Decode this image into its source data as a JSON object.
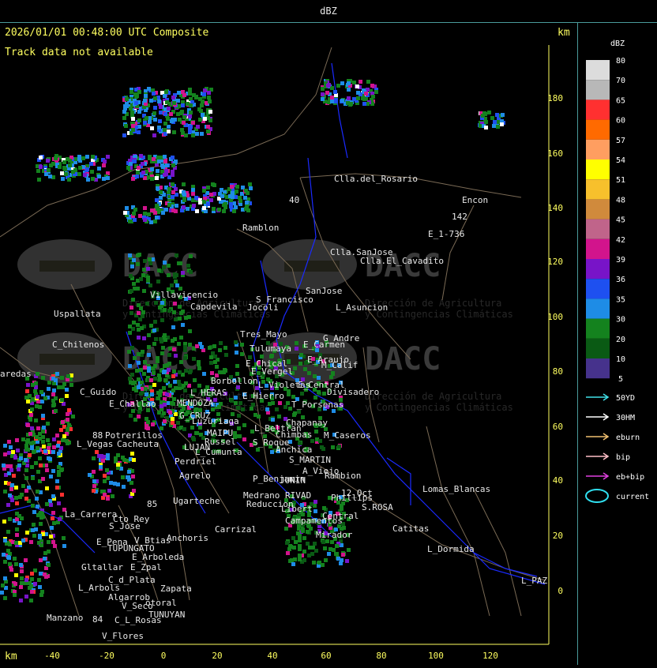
{
  "window": {
    "title": "dBZ"
  },
  "map": {
    "header": "2026/01/01 00:48:00 UTC Composite",
    "notice": "Track data not available",
    "unit_top": "km",
    "unit_bottom": "km",
    "watermark": {
      "name": "DACC",
      "line1": "Dirección de Agricultura",
      "line2": "y Contingencias Climáticas"
    },
    "x_ticks": [
      "-40",
      "-20",
      "0",
      "20",
      "40",
      "60",
      "80",
      "100",
      "120"
    ],
    "y_ticks": [
      "180",
      "160",
      "140",
      "120",
      "100",
      "80",
      "60",
      "40",
      "20",
      "0"
    ],
    "places": [
      {
        "name": "Clla.del_Rosario"
      },
      {
        "name": "Encon"
      },
      {
        "name": "142"
      },
      {
        "name": "E_1-736"
      },
      {
        "name": "Ramblon"
      },
      {
        "name": "Clla.SanJose"
      },
      {
        "name": "Clla.El_Cavadito"
      },
      {
        "name": "Villavicencio"
      },
      {
        "name": "Capdevila"
      },
      {
        "name": "S_Francisco"
      },
      {
        "name": "Jocoli"
      },
      {
        "name": "SanJose"
      },
      {
        "name": "L_Asuncion"
      },
      {
        "name": "Uspallata"
      },
      {
        "name": "Tres_Mayo"
      },
      {
        "name": "G_Andre"
      },
      {
        "name": "Tulumaya"
      },
      {
        "name": "E_Carmen"
      },
      {
        "name": "C_Chilenos"
      },
      {
        "name": "E_Chical"
      },
      {
        "name": "E_Araujo"
      },
      {
        "name": "M_Calif"
      },
      {
        "name": "E_Vergel"
      },
      {
        "name": "aredas"
      },
      {
        "name": "Borbollon"
      },
      {
        "name": "E_Central"
      },
      {
        "name": "L_Violetas"
      },
      {
        "name": "Divisadero"
      },
      {
        "name": "C_Guido"
      },
      {
        "name": "L_HERAS"
      },
      {
        "name": "E_Hierro"
      },
      {
        "name": "E_Challao"
      },
      {
        "name": "MENDOZA"
      },
      {
        "name": "T_Porsenas"
      },
      {
        "name": "G_CRUZ"
      },
      {
        "name": "Luzuriaga"
      },
      {
        "name": "Chapanay"
      },
      {
        "name": "L_Beltran"
      },
      {
        "name": "Potrerillos"
      },
      {
        "name": "MAIPU"
      },
      {
        "name": "Chimbas"
      },
      {
        "name": "M_Caseros"
      },
      {
        "name": "L_Vegas"
      },
      {
        "name": "Cacheuta"
      },
      {
        "name": "Russel"
      },
      {
        "name": "S_Roque"
      },
      {
        "name": "LUJAN"
      },
      {
        "name": "Anchica"
      },
      {
        "name": "L_Cumunta"
      },
      {
        "name": "S_MARTIN"
      },
      {
        "name": "Perdriel"
      },
      {
        "name": "A_Viejo"
      },
      {
        "name": "Rambion"
      },
      {
        "name": "Agrelo"
      },
      {
        "name": "P_Benjamin"
      },
      {
        "name": "JUNIN"
      },
      {
        "name": "12_Oct"
      },
      {
        "name": "Lomas_Blancas"
      },
      {
        "name": "Ugarteche"
      },
      {
        "name": "Phillips"
      },
      {
        "name": "S.ROSA"
      },
      {
        "name": "Medrano"
      },
      {
        "name": "RIVAD"
      },
      {
        "name": "Reduccion"
      },
      {
        "name": "Libert"
      },
      {
        "name": "La_Carrera"
      },
      {
        "name": "Cto_Rey"
      },
      {
        "name": "Central"
      },
      {
        "name": "Catitas"
      },
      {
        "name": "S_Jose"
      },
      {
        "name": "Carrizal"
      },
      {
        "name": "Campamentos"
      },
      {
        "name": "E_Pena"
      },
      {
        "name": "V_Btias"
      },
      {
        "name": "Anchoris"
      },
      {
        "name": "Mirador"
      },
      {
        "name": "TUPUNGATO"
      },
      {
        "name": "L_Dormida"
      },
      {
        "name": "E_Arboleda"
      },
      {
        "name": "Gltallar"
      },
      {
        "name": "E_Zpal"
      },
      {
        "name": "C_d_Plata"
      },
      {
        "name": "L_PAZ"
      },
      {
        "name": "L_Arbols"
      },
      {
        "name": "Zapata"
      },
      {
        "name": "Algarrob"
      },
      {
        "name": "V_Seco"
      },
      {
        "name": "otoral"
      },
      {
        "name": "TUNUYAN"
      },
      {
        "name": "Manzano"
      },
      {
        "name": "C_L_Rosas"
      },
      {
        "name": "V_Flores"
      },
      {
        "name": "88"
      },
      {
        "name": "85"
      },
      {
        "name": "84"
      },
      {
        "name": "40"
      }
    ]
  },
  "legend": {
    "title": "dBZ",
    "colors": [
      "#dcdcdc",
      "#b8b8b8",
      "#ff3030",
      "#ff6a00",
      "#ff9e60",
      "#ffff00",
      "#f7c02c",
      "#d08a3c",
      "#c0648a",
      "#d2148c",
      "#7814c8",
      "#1e50f0",
      "#1e8ce6",
      "#14821e",
      "#0a5a14",
      "#46328c"
    ],
    "scale_labels": [
      "80",
      "70",
      "65",
      "60",
      "57",
      "54",
      "51",
      "48",
      "45",
      "42",
      "39",
      "36",
      "35",
      "30",
      "20",
      "10",
      "5"
    ],
    "tracks": [
      {
        "label": "50YD",
        "color": "#40e0e8"
      },
      {
        "label": "30HM",
        "color": "#ffffff"
      },
      {
        "label": "eburn",
        "color": "#f0c070"
      },
      {
        "label": "bip",
        "color": "#ffc0c8"
      },
      {
        "label": "eb+bip",
        "color": "#e040e0"
      },
      {
        "label": "current",
        "color": "#30e0f0"
      }
    ]
  }
}
